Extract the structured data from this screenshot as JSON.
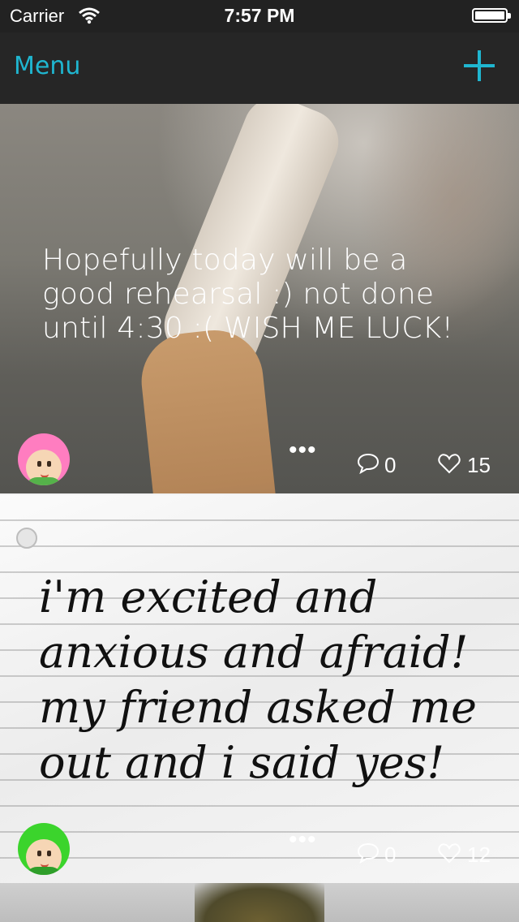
{
  "status_bar": {
    "carrier": "Carrier",
    "time": "7:57 PM"
  },
  "navbar": {
    "menu_label": "Menu"
  },
  "posts": [
    {
      "text": "Hopefully today will be a good rehearsal :) not done until 4:30 :( WISH ME LUCK!",
      "comments": "0",
      "likes": "15"
    },
    {
      "text": "i'm excited and anxious and afraid! my friend asked me out and i said yes!",
      "comments": "0",
      "likes": "12"
    }
  ],
  "icons": [
    "wifi-icon",
    "battery-icon",
    "plus-icon",
    "more-icon",
    "comment-icon",
    "heart-icon",
    "avatar"
  ],
  "colors": {
    "accent": "#1fb6d0",
    "nav_bg": "#262626"
  }
}
